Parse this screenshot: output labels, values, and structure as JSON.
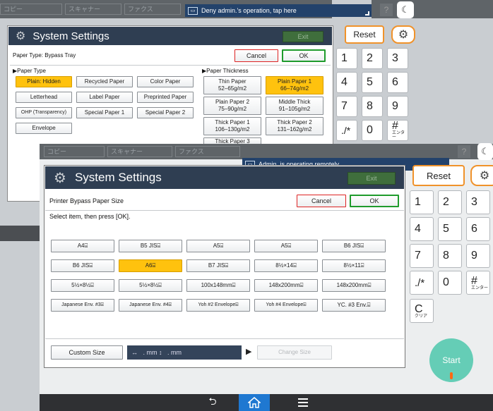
{
  "back": {
    "tabs": [
      "コピー",
      "スキャナー",
      "ファクス"
    ],
    "notice": "Deny admin.'s operation, tap here",
    "help": "?",
    "title": "System Settings",
    "exit": "Exit",
    "reset": "Reset",
    "header_label": "Paper Type: Bypass Tray",
    "cancel": "Cancel",
    "ok": "OK",
    "paper_type_label": "▶Paper Type",
    "paper_types": [
      "Plain: Hidden",
      "Recycled Paper",
      "Color Paper",
      "Letterhead",
      "Label Paper",
      "Preprinted Paper",
      "OHP (Transparency)",
      "Special Paper 1",
      "Special Paper 2",
      "Envelope"
    ],
    "thickness_label": "▶Paper Thickness",
    "thickness": [
      {
        "l1": "Thin Paper",
        "l2": "52–65g/m2"
      },
      {
        "l1": "Plain Paper 1",
        "l2": "66–74g/m2"
      },
      {
        "l1": "Plain Paper 2",
        "l2": "75–90g/m2"
      },
      {
        "l1": "Middle Thick",
        "l2": "91–105g/m2"
      },
      {
        "l1": "Thick Paper 1",
        "l2": "106–130g/m2"
      },
      {
        "l1": "Thick Paper 2",
        "l2": "131–162g/m2"
      },
      {
        "l1": "Thick Paper 3",
        "l2": ""
      }
    ],
    "keys": [
      "1",
      "2",
      "3",
      "4",
      "5",
      "6",
      "7",
      "8",
      "9",
      "./*",
      "0",
      "#"
    ],
    "hash_sub": "エンター"
  },
  "front": {
    "tabs": [
      "コピー",
      "スキャナー",
      "ファクス"
    ],
    "notice": "Admin. is operating remotely",
    "help": "?",
    "title": "System Settings",
    "exit": "Exit",
    "reset": "Reset",
    "header_label": "Printer Bypass Paper Size",
    "cancel": "Cancel",
    "ok": "OK",
    "instruction": "Select item, then press [OK].",
    "sizes": [
      "A4⌸",
      "B5 JIS⌸",
      "A5⌸",
      "A5⌸",
      "B6 JIS⌸",
      "B6 JIS⌸",
      "A6⌸",
      "B7 JIS⌸",
      "8½×14⌸",
      "8½×11⌸",
      "5½×8½⌸",
      "5½×8½⌸",
      "100x148mm⌸",
      "148x200mm⌸",
      "148x200mm⌸",
      "Japanese Env. #3⌸",
      "Japanese Env. #4⌸",
      "Yoh #2 Envelope⌸",
      "Yoh #4 Envelope⌸",
      "YC. #3 Env.⌸"
    ],
    "custom_size": "Custom Size",
    "custom_field": "↔   . mm ↕   . mm",
    "change_size": "Change Size",
    "keys": [
      "1",
      "2",
      "3",
      "4",
      "5",
      "6",
      "7",
      "8",
      "9",
      "./*",
      "0",
      "#"
    ],
    "hash_sub": "エンター",
    "clear": "C",
    "clear_sub": "クリア",
    "start": "Start"
  },
  "bottom_nav": [
    "back-icon",
    "home-icon",
    "menu-icon"
  ]
}
